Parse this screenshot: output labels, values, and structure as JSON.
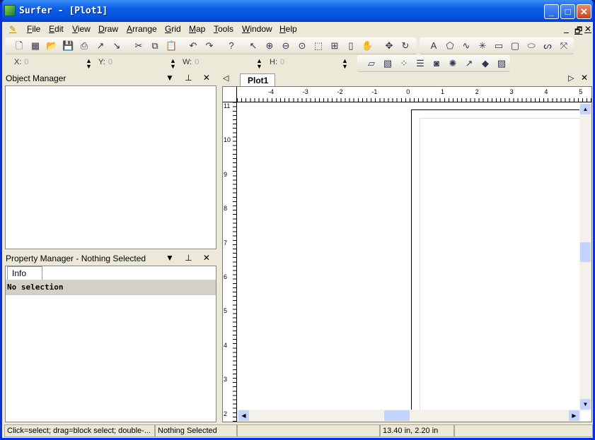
{
  "window": {
    "title": "Surfer - [Plot1]",
    "min": "_",
    "max": "□",
    "close": "✕"
  },
  "menu": [
    "File",
    "Edit",
    "View",
    "Draw",
    "Arrange",
    "Grid",
    "Map",
    "Tools",
    "Window",
    "Help"
  ],
  "mdi": {
    "min": "_",
    "restore": "🗗",
    "close": "✕"
  },
  "toolbar1": [
    "new-plot-icon",
    "new-worksheet-icon",
    "open-icon",
    "save-icon",
    "print-icon",
    "export-icon",
    "import-icon",
    "cut-icon",
    "copy-icon",
    "paste-icon",
    "undo-icon",
    "redo-icon",
    "help-icon",
    "select-icon",
    "zoom-in-icon",
    "zoom-out-icon",
    "zoom-fit-icon",
    "zoom-rect-icon",
    "zoom-select-icon",
    "zoom-page-icon",
    "pan-icon",
    "trackball-icon",
    "rotate-icon"
  ],
  "toolbar2": [
    "text-icon",
    "polygon-icon",
    "polyline-icon",
    "symbol-icon",
    "rectangle-icon",
    "rounded-rect-icon",
    "ellipse-icon",
    "spline-icon",
    "reshape-icon"
  ],
  "toolbar3": [
    "base-map-icon",
    "image-map-icon",
    "post-map-icon",
    "legend-icon",
    "snapshot-icon",
    "spark-icon",
    "vector-map-icon",
    "surface-map-icon",
    "image-icon"
  ],
  "coords": {
    "x_label": "X:",
    "x": "0",
    "y_label": "Y:",
    "y": "0",
    "w_label": "W:",
    "w": "0",
    "h_label": "H:",
    "h": "0"
  },
  "object_manager": {
    "title": "Object Manager"
  },
  "property_manager": {
    "title": "Property Manager - Nothing Selected",
    "tab": "Info",
    "message": "No selection"
  },
  "doc_tab": "Plot1",
  "hruler_labels": [
    "-4",
    "-3",
    "-2",
    "-1",
    "0",
    "1",
    "2",
    "3",
    "4",
    "5"
  ],
  "vruler_labels": [
    "11",
    "10",
    "9",
    "8",
    "7",
    "6",
    "5",
    "4",
    "3",
    "2"
  ],
  "status": {
    "hint": "Click=select; drag=block select; double-...",
    "selection": "Nothing Selected",
    "position": "13.40 in, 2.20 in"
  }
}
